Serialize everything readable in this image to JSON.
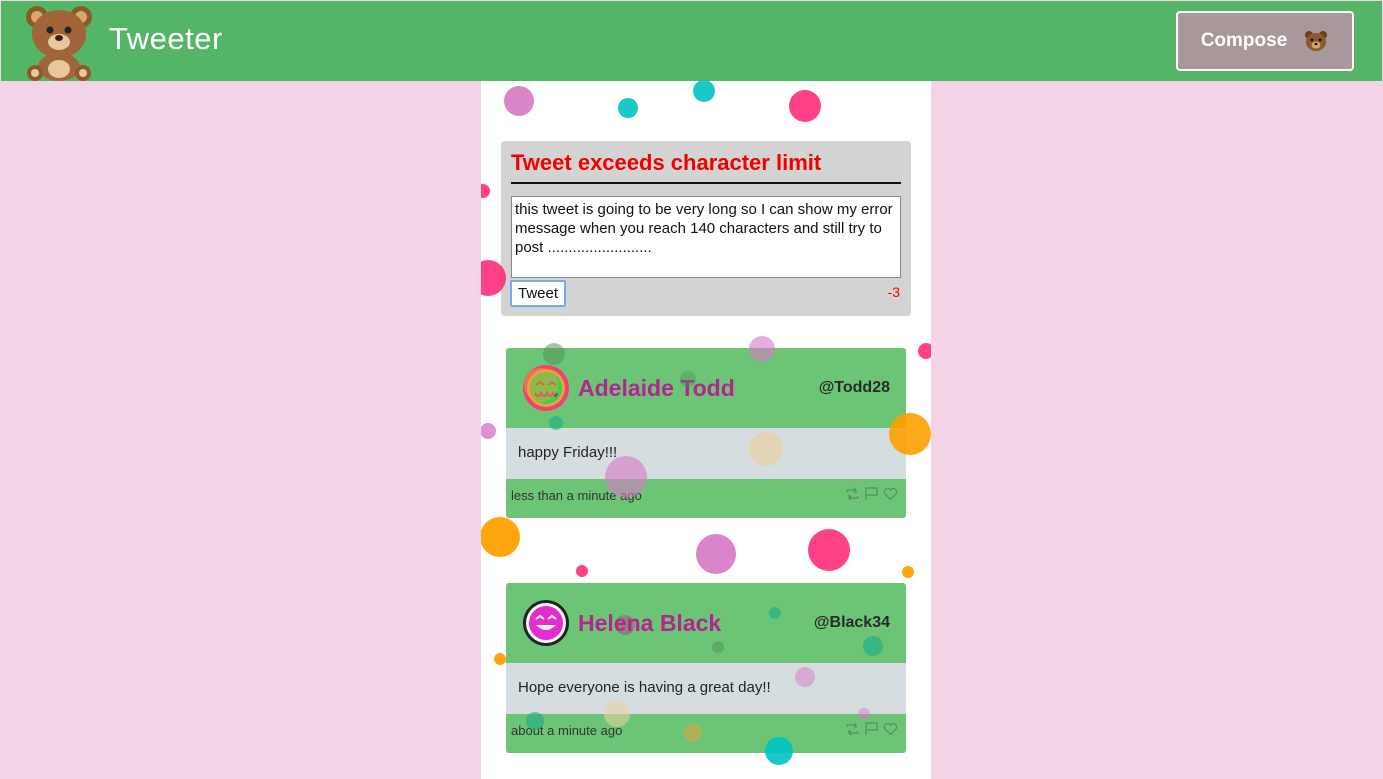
{
  "app": {
    "title": "Tweeter"
  },
  "header": {
    "compose_label": "Compose"
  },
  "compose": {
    "error": "Tweet exceeds character limit",
    "text": "this tweet is going to be very long so I can show my error message when you reach 140 characters and still try to post .........................",
    "tweet_label": "Tweet",
    "counter": "-3"
  },
  "tweets": [
    {
      "name": "Adelaide Todd",
      "handle": "@Todd28",
      "content": "happy Friday!!!",
      "time": "less than a minute ago"
    },
    {
      "name": "Helena Black",
      "handle": "@Black34",
      "content": "Hope everyone is having a great day!!",
      "time": "about a minute ago"
    }
  ],
  "colors": {
    "header": "#55b567",
    "page_bg": "#f3d4e6",
    "compose_button": "#a99899",
    "error": "#f20000",
    "tweet_card": "#6cc576",
    "tweet_name": "#b4258f"
  },
  "icons": [
    "bear-logo-icon",
    "bear-emoji-icon",
    "retweet-icon",
    "flag-icon",
    "heart-icon"
  ]
}
